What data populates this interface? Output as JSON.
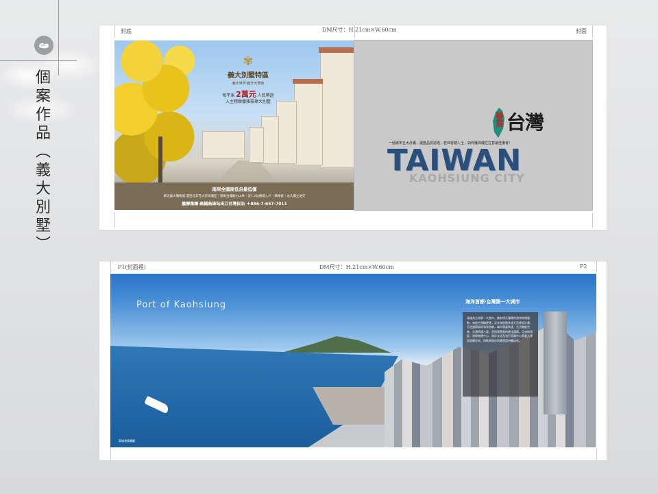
{
  "sidebar": {
    "title_chars": [
      "個",
      "案",
      "作",
      "品",
      "︵",
      "義",
      "大",
      "別",
      "墅",
      "︶"
    ]
  },
  "spread1": {
    "left_label": "封底",
    "center_label": "DM尺寸：H.21cm×W.60cm",
    "right_label": "封面",
    "back_cover": {
      "brand_name": "義大別墅特區",
      "brand_sub": "義大世界‧義守大學旁",
      "copy_line1_pre": "每平米",
      "copy_big": "2萬元",
      "copy_line1_post": "人民幣起",
      "copy_line2": "入主精緻優雅豪華大別墅",
      "footer_line1": "南岸全國周低自最低價",
      "footer_line2": "鄰近義大購物城‧漫遊北非花大宗海灘區｜緊鄰台鐵動力山林｜近1-2站機場入戶｜精緻修｜永久獨立透天",
      "footer_line3": "義聯集團‧高鐵高雄站出口台灣自治 ＋886-7-657-7011"
    },
    "front_cover": {
      "yiju": "移居",
      "taiwan_cn": "台灣",
      "tagline": "一個城市五大計畫，讓團品質認證，若非營建人士，如何獲得瑰在在意最佳機會！",
      "taiwan_en": "TAIWAN",
      "city_en": "KAOHSIUNG CITY"
    }
  },
  "spread2": {
    "left_label": "P1(封面裡)",
    "center_label": "DM尺寸：H.21cm×W.60cm",
    "right_label": "P2",
    "port_label": "Port of Kaohsiung",
    "photo_caption": "高雄港鳥瞰圖",
    "info_title": "海洋首都‧台灣第一大城市",
    "info_body": "高雄為台灣第一大港市，擁有得天獨厚的港灣地理優勢，海陸空運輸便捷，近年來推動多項大型建設計畫，打造國際級的海洋首都。城市發展快速，生活機能完善，交通四通八達，是投資置產的最佳選擇。亞洲新灣區、港埠旅運中心、海洋文化及流行音樂中心等重大建設陸續完成，帶動周邊房地產價值持續成長。"
  }
}
